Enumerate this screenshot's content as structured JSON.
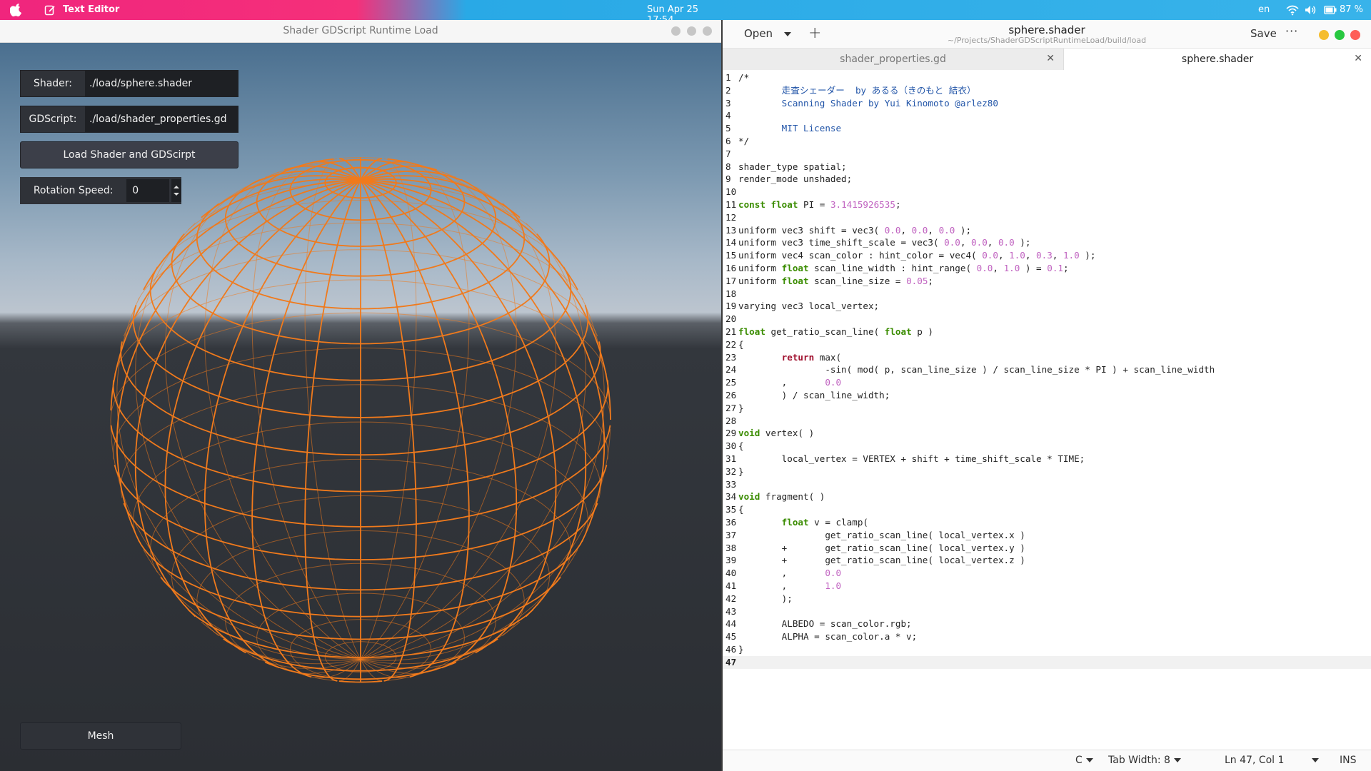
{
  "topbar": {
    "app_name": "Text Editor",
    "clock": "Sun Apr 25  17:54",
    "language": "en",
    "battery": "87 %"
  },
  "godot": {
    "window_title": "Shader GDScript Runtime Load",
    "shader_label": "Shader:",
    "shader_path": "./load/sphere.shader",
    "gdscript_label": "GDScript:",
    "gdscript_path": "./load/shader_properties.gd",
    "load_button": "Load Shader and GDScirpt",
    "rotation_label": "Rotation Speed:",
    "rotation_value": "0",
    "mesh_button": "Mesh",
    "colors": {
      "wire": "#f07a1c"
    }
  },
  "editor": {
    "open_label": "Open",
    "save_label": "Save",
    "file_name": "sphere.shader",
    "file_path": "~/Projects/ShaderGDScriptRuntimeLoad/build/load",
    "tabs": [
      {
        "label": "shader_properties.gd",
        "active": false
      },
      {
        "label": "sphere.shader",
        "active": true
      }
    ],
    "lines": [
      "/*",
      "\t走査シェーダー  by あるる（きのもと 結衣）",
      "\tScanning Shader by Yui Kinomoto @arlez80",
      "",
      "\tMIT License",
      "*/",
      "",
      "shader_type spatial;",
      "render_mode unshaded;",
      "",
      "const float PI = 3.1415926535;",
      "",
      "uniform vec3 shift = vec3( 0.0, 0.0, 0.0 );",
      "uniform vec3 time_shift_scale = vec3( 0.0, 0.0, 0.0 );",
      "uniform vec4 scan_color : hint_color = vec4( 0.0, 1.0, 0.3, 1.0 );",
      "uniform float scan_line_width : hint_range( 0.0, 1.0 ) = 0.1;",
      "uniform float scan_line_size = 0.05;",
      "",
      "varying vec3 local_vertex;",
      "",
      "float get_ratio_scan_line( float p )",
      "{",
      "\treturn max(",
      "\t\t-sin( mod( p, scan_line_size ) / scan_line_size * PI ) + scan_line_width",
      "\t,\t0.0",
      "\t) / scan_line_width;",
      "}",
      "",
      "void vertex( )",
      "{",
      "\tlocal_vertex = VERTEX + shift + time_shift_scale * TIME;",
      "}",
      "",
      "void fragment( )",
      "{",
      "\tfloat v = clamp(",
      "\t\tget_ratio_scan_line( local_vertex.x )",
      "\t+\tget_ratio_scan_line( local_vertex.y )",
      "\t+\tget_ratio_scan_line( local_vertex.z )",
      "\t,\t0.0",
      "\t,\t1.0",
      "\t);",
      "",
      "\tALBEDO = scan_color.rgb;",
      "\tALPHA = scan_color.a * v;",
      "}",
      ""
    ],
    "status": {
      "language": "C",
      "tab_width": "Tab Width: 8",
      "cursor": "Ln 47, Col 1",
      "mode": "INS"
    },
    "colors": {
      "keyword": "#3a8c00",
      "number": "#c062c0",
      "comment": "#2255a8",
      "return": "#a0102e"
    }
  }
}
